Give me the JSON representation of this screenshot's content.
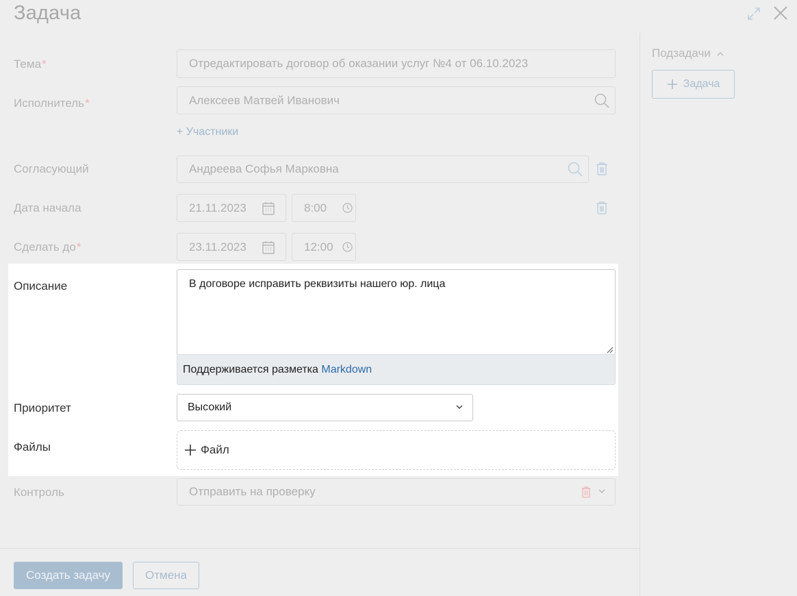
{
  "header": {
    "title": "Задача",
    "icons": [
      "expand-icon",
      "close-icon"
    ]
  },
  "form": {
    "topic": {
      "label": "Тема",
      "required": "*",
      "value": "Отредактировать договор об оказании услуг №4 от 06.10.2023"
    },
    "assignee": {
      "label": "Исполнитель",
      "required": "*",
      "value": "Алексеев Матвей Иванович"
    },
    "participants_link": "+ Участники",
    "approver": {
      "label": "Согласующий",
      "value": "Андреева Софья Марковна"
    },
    "start": {
      "label": "Дата начала",
      "date": "21.11.2023",
      "time": "8:00"
    },
    "due": {
      "label": "Сделать до",
      "required": "*",
      "date": "23.11.2023",
      "time": "12:00"
    },
    "description": {
      "label": "Описание",
      "value": "В договоре исправить реквизиты нашего юр. лица",
      "hint": "Поддерживается разметка",
      "hint_link": "Markdown"
    },
    "priority": {
      "label": "Приоритет",
      "value": "Высокий"
    },
    "files": {
      "label": "Файлы",
      "add_label": "Файл"
    },
    "control": {
      "label": "Контроль",
      "value": "Отправить на проверку"
    }
  },
  "footer": {
    "create_label": "Создать задачу",
    "cancel_label": "Отмена"
  },
  "sidebar": {
    "subtasks_label": "Подзадачи",
    "add_task_label": "Задача"
  },
  "colors": {
    "accent": "#2d6aa8",
    "required": "#f0b3b3",
    "disabled_button": "#a9bdd0"
  }
}
